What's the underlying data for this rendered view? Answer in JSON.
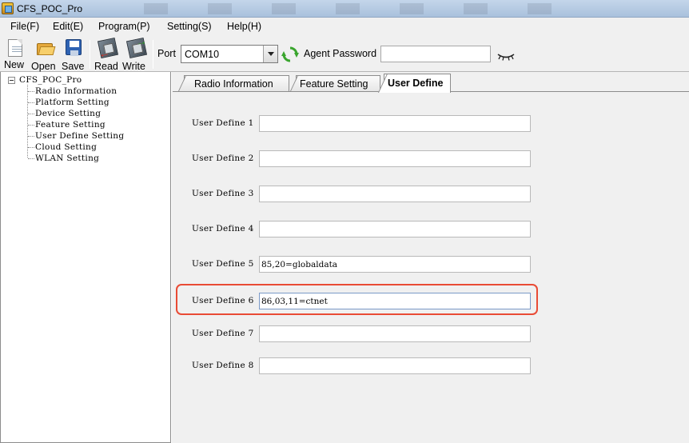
{
  "window": {
    "title": "CFS_POC_Pro"
  },
  "menu": [
    {
      "label": "File(F)"
    },
    {
      "label": "Edit(E)"
    },
    {
      "label": "Program(P)"
    },
    {
      "label": "Setting(S)"
    },
    {
      "label": "Help(H)"
    }
  ],
  "toolbar": {
    "new_label": "New",
    "open_label": "Open",
    "save_label": "Save",
    "read_label": "Read",
    "write_label": "Write",
    "port_label": "Port",
    "port_value": "COM10",
    "agent_password_label": "Agent Password",
    "agent_password_value": ""
  },
  "tree": {
    "root": "CFS_POC_Pro",
    "items": [
      "Radio Information",
      "Platform Setting",
      "Device Setting",
      "Feature Setting",
      "User Define Setting",
      "Cloud Setting",
      "WLAN Setting"
    ]
  },
  "tabs": [
    {
      "label": "Radio Information"
    },
    {
      "label": "Feature Setting"
    },
    {
      "label": "User Define"
    }
  ],
  "user_define": [
    {
      "label": "User Define 1",
      "value": ""
    },
    {
      "label": "User Define 2",
      "value": ""
    },
    {
      "label": "User Define 3",
      "value": ""
    },
    {
      "label": "User Define 4",
      "value": ""
    },
    {
      "label": "User Define 5",
      "value": "85,20=globaldata"
    },
    {
      "label": "User Define 6",
      "value": "86,03,11=ctnet"
    },
    {
      "label": "User Define 7",
      "value": ""
    },
    {
      "label": "User Define 8",
      "value": ""
    }
  ],
  "colors": {
    "highlight": "#e94b35",
    "refresh_green": "#3aa52e"
  }
}
